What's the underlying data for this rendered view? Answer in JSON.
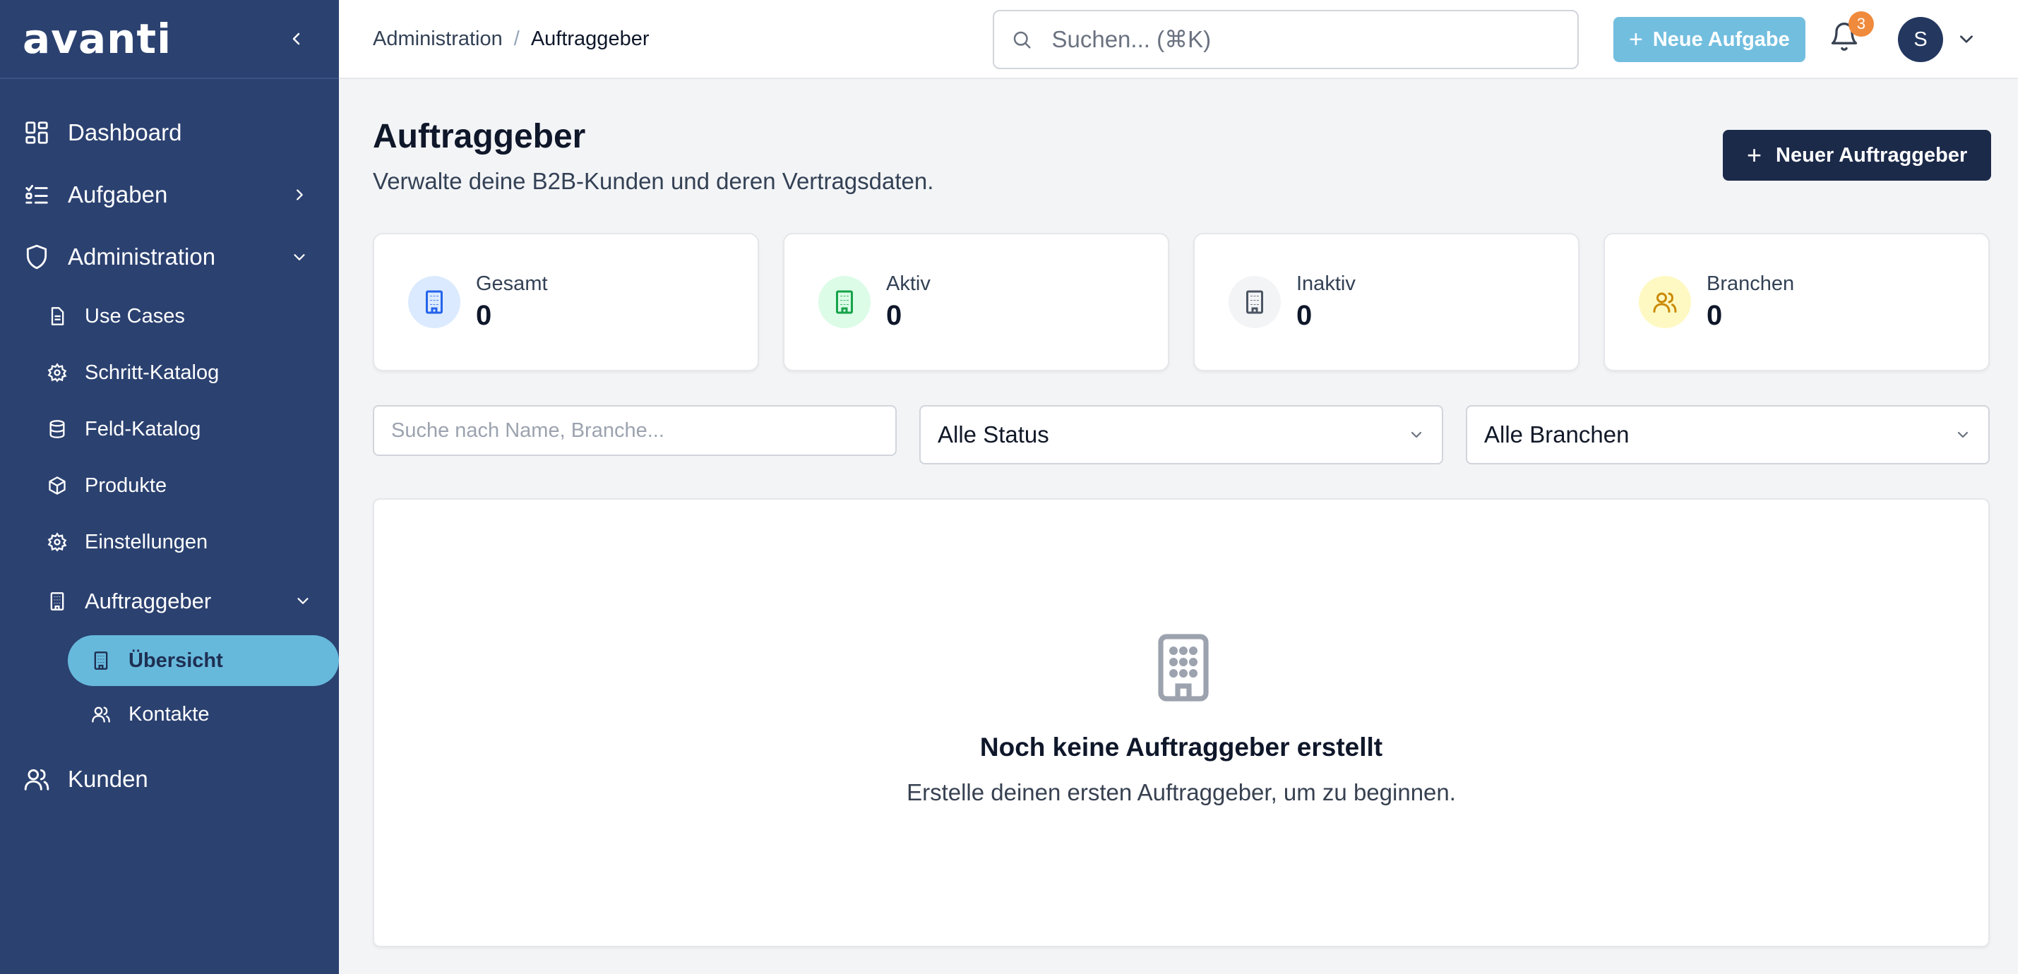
{
  "sidebar": {
    "logo": "avanti",
    "items": [
      {
        "label": "Dashboard",
        "icon": "dashboard-icon"
      },
      {
        "label": "Aufgaben",
        "icon": "task-list-icon"
      },
      {
        "label": "Administration",
        "icon": "shield-icon"
      },
      {
        "label": "Use Cases",
        "icon": "document-icon"
      },
      {
        "label": "Schritt-Katalog",
        "icon": "gear-icon"
      },
      {
        "label": "Feld-Katalog",
        "icon": "database-icon"
      },
      {
        "label": "Produkte",
        "icon": "box-icon"
      },
      {
        "label": "Einstellungen",
        "icon": "gear-icon"
      },
      {
        "label": "Auftraggeber",
        "icon": "building-icon"
      },
      {
        "label": "Übersicht",
        "icon": "building-icon"
      },
      {
        "label": "Kontakte",
        "icon": "users-icon"
      },
      {
        "label": "Kunden",
        "icon": "users-icon"
      }
    ]
  },
  "header": {
    "breadcrumb": [
      "Administration",
      "Auftraggeber"
    ],
    "search_placeholder": "Suchen... (⌘K)",
    "new_task_label": "Neue Aufgabe",
    "notification_count": "3",
    "avatar_initial": "S"
  },
  "main": {
    "title": "Auftraggeber",
    "subtitle": "Verwalte deine B2B-Kunden und deren Vertragsdaten.",
    "new_client_label": "Neuer Auftraggeber",
    "stats": [
      {
        "label": "Gesamt",
        "value": "0",
        "color": "#2563eb"
      },
      {
        "label": "Aktiv",
        "value": "0",
        "color": "#16a34a"
      },
      {
        "label": "Inaktiv",
        "value": "0",
        "color": "#4b5563"
      },
      {
        "label": "Branchen",
        "value": "0",
        "color": "#ca8a04"
      }
    ],
    "filter_placeholder": "Suche nach Name, Branche...",
    "status_select": "Alle Status",
    "branch_select": "Alle Branchen",
    "empty_title": "Noch keine Auftraggeber erstellt",
    "empty_subtitle": "Erstelle deinen ersten Auftraggeber, um zu beginnen."
  },
  "colors": {
    "sidebar_bg": "#2b4170",
    "active_item": "#67b9dc",
    "primary_button": "#1c2a4a",
    "accent_button": "#72bedf",
    "badge": "#f08a3c"
  }
}
